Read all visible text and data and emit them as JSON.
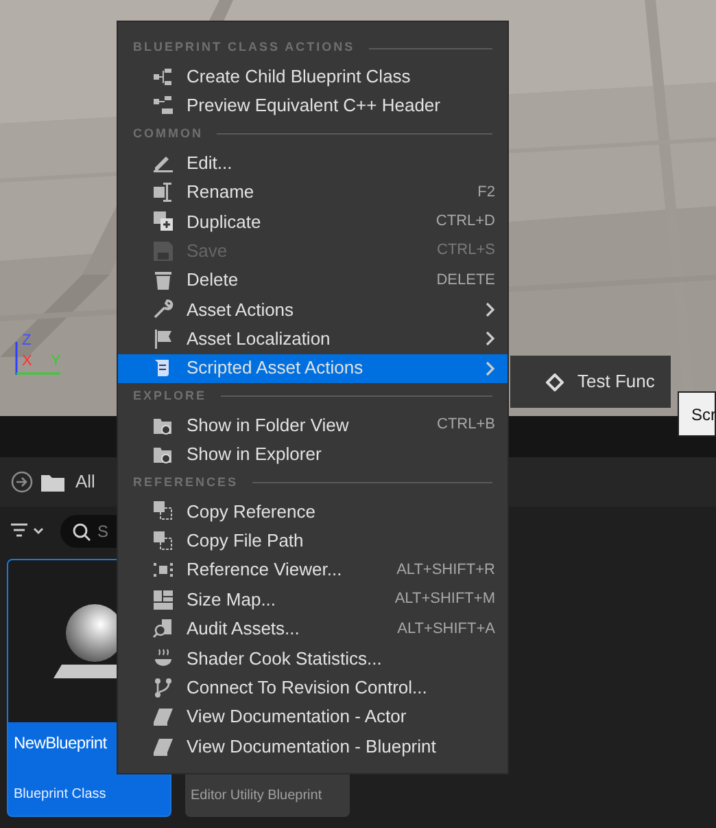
{
  "viewport": {
    "axes": [
      "Z",
      "X",
      "Y"
    ]
  },
  "content_browser": {
    "path": "All",
    "search": {
      "placeholder": "S"
    },
    "assets": [
      {
        "name": "NewBlueprint",
        "type": "Blueprint Class",
        "selected": true
      },
      {
        "type": "Editor Utility Blueprint",
        "selected": false
      }
    ]
  },
  "context_menu": {
    "sections": [
      {
        "heading": "BLUEPRINT CLASS ACTIONS",
        "items": [
          {
            "label": "Create Child Blueprint Class",
            "disabled": false,
            "submenu": false,
            "selected": false
          },
          {
            "label": "Preview Equivalent C++ Header",
            "disabled": false,
            "submenu": false,
            "selected": false
          }
        ]
      },
      {
        "heading": "COMMON",
        "items": [
          {
            "label": "Edit...",
            "disabled": false,
            "submenu": false,
            "selected": false
          },
          {
            "label": "Rename",
            "shortcut": "F2",
            "disabled": false,
            "submenu": false,
            "selected": false
          },
          {
            "label": "Duplicate",
            "shortcut": "CTRL+D",
            "disabled": false,
            "submenu": false,
            "selected": false
          },
          {
            "label": "Save",
            "shortcut": "CTRL+S",
            "disabled": true,
            "submenu": false,
            "selected": false
          },
          {
            "label": "Delete",
            "shortcut": "DELETE",
            "disabled": false,
            "submenu": false,
            "selected": false
          },
          {
            "label": "Asset Actions",
            "disabled": false,
            "submenu": true,
            "selected": false
          },
          {
            "label": "Asset Localization",
            "disabled": false,
            "submenu": true,
            "selected": false
          },
          {
            "label": "Scripted Asset Actions",
            "disabled": false,
            "submenu": true,
            "selected": true
          }
        ]
      },
      {
        "heading": "EXPLORE",
        "items": [
          {
            "label": "Show in Folder View",
            "shortcut": "CTRL+B",
            "disabled": false,
            "submenu": false,
            "selected": false
          },
          {
            "label": "Show in Explorer",
            "disabled": false,
            "submenu": false,
            "selected": false
          }
        ]
      },
      {
        "heading": "REFERENCES",
        "items": [
          {
            "label": "Copy Reference",
            "disabled": false,
            "submenu": false,
            "selected": false
          },
          {
            "label": "Copy File Path",
            "disabled": false,
            "submenu": false,
            "selected": false
          },
          {
            "label": "Reference Viewer...",
            "shortcut": "ALT+SHIFT+R",
            "disabled": false,
            "submenu": false,
            "selected": false
          },
          {
            "label": "Size Map...",
            "shortcut": "ALT+SHIFT+M",
            "disabled": false,
            "submenu": false,
            "selected": false
          },
          {
            "label": "Audit Assets...",
            "shortcut": "ALT+SHIFT+A",
            "disabled": false,
            "submenu": false,
            "selected": false
          },
          {
            "label": "Shader Cook Statistics...",
            "disabled": false,
            "submenu": false,
            "selected": false
          },
          {
            "label": "Connect To Revision Control...",
            "disabled": false,
            "submenu": false,
            "selected": false
          },
          {
            "label": "View Documentation - Actor",
            "disabled": false,
            "submenu": false,
            "selected": false
          },
          {
            "label": "View Documentation - Blueprint",
            "disabled": false,
            "submenu": false,
            "selected": false
          }
        ]
      }
    ]
  },
  "submenu": {
    "items": [
      {
        "label": "Test Func"
      }
    ]
  },
  "tooltip": {
    "text": "Scr"
  }
}
